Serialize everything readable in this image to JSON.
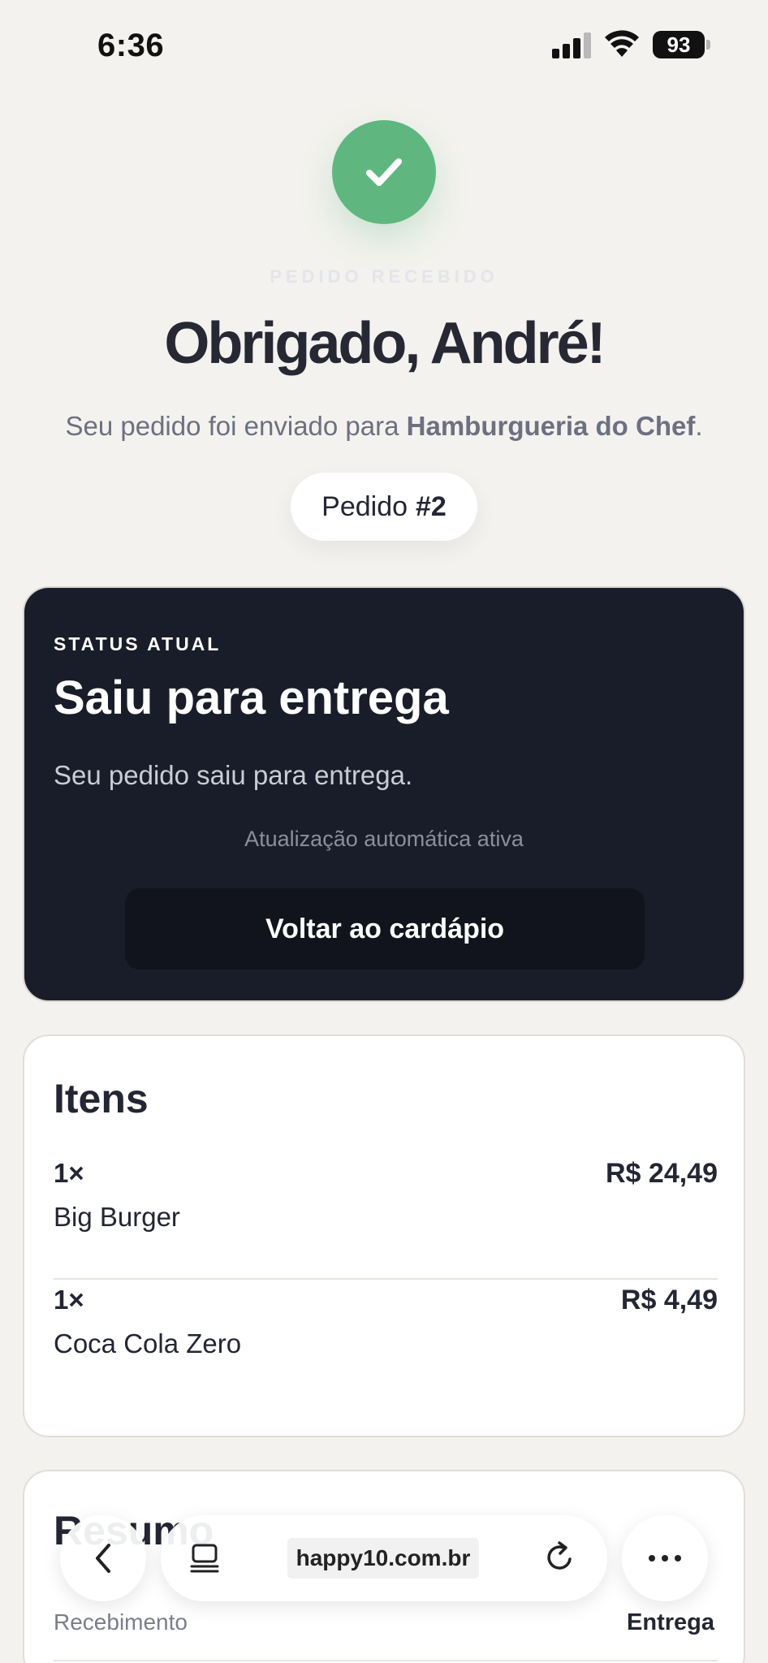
{
  "status_bar": {
    "time": "6:36",
    "battery": "93"
  },
  "header": {
    "eyebrow": "PEDIDO RECEBIDO",
    "title": "Obrigado, André!",
    "subtitle_prefix": "Seu pedido foi enviado para ",
    "restaurant": "Hamburgueria do Chef",
    "subtitle_suffix": ".",
    "order_label": "Pedido",
    "order_number": "#2"
  },
  "status_card": {
    "eyebrow": "STATUS ATUAL",
    "title": "Saiu para entrega",
    "description": "Seu pedido saiu para entrega.",
    "auto_update": "Atualização automática ativa",
    "back_button": "Voltar ao cardápio"
  },
  "items_card": {
    "title": "Itens",
    "items": [
      {
        "qty": "1×",
        "name": "Big Burger",
        "price": "R$ 24,49"
      },
      {
        "qty": "1×",
        "name": "Coca Cola Zero",
        "price": "R$ 4,49"
      }
    ]
  },
  "resumo_card": {
    "title": "Resumo",
    "receb_label": "Recebimento",
    "receb_value": "Entrega"
  },
  "browser": {
    "url": "happy10.com.br",
    "icons": [
      "chevron-left-icon",
      "tabs-icon",
      "reload-icon",
      "more-icon"
    ]
  },
  "colors": {
    "background": "#f3f2ee",
    "success": "#5fb77f",
    "dark_card": "#191d29"
  }
}
